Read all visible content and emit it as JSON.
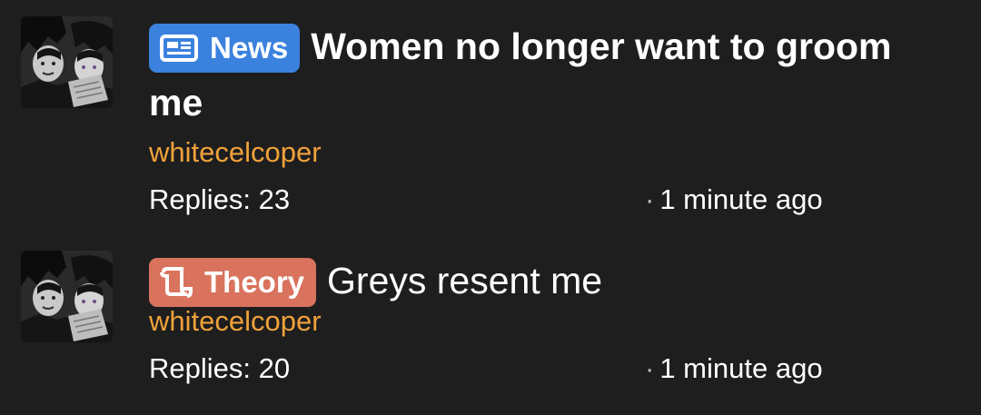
{
  "threads": [
    {
      "badge": {
        "label": "News",
        "icon": "newspaper-icon",
        "color": "#3b82de"
      },
      "title": "Women no longer want to groom me",
      "author": "whitecelcoper",
      "replies": "Replies: 23",
      "time": "1 minute ago",
      "time_separator": "·"
    },
    {
      "badge": {
        "label": "Theory",
        "icon": "scroll-icon",
        "color": "#d9735d"
      },
      "title": "Greys resent me",
      "author": "whitecelcoper",
      "replies": "Replies: 20",
      "time": "1 minute ago",
      "time_separator": "·"
    }
  ],
  "colors": {
    "background": "#1e1e1f",
    "author": "#f0a23a",
    "text": "#ffffff"
  }
}
